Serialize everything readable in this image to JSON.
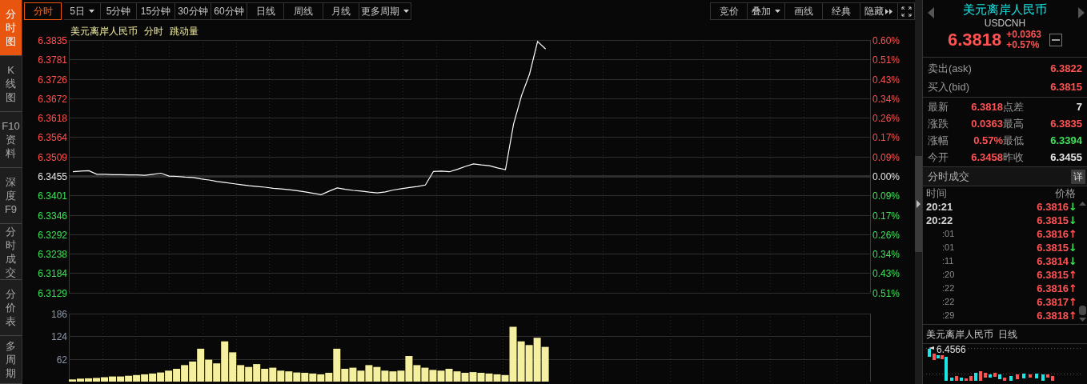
{
  "side_tabs": [
    {
      "label": "分时图",
      "selected": true
    },
    {
      "label": "K线图",
      "selected": false
    },
    {
      "label": "F10资料",
      "selected": false
    },
    {
      "label": "深度F9",
      "selected": false
    },
    {
      "label": "分时成交",
      "selected": false
    },
    {
      "label": "分价表",
      "selected": false
    },
    {
      "label": "多周期",
      "selected": false
    }
  ],
  "period_tabs": [
    {
      "label": "分时",
      "selected": true,
      "dropdown": false
    },
    {
      "label": "5日",
      "selected": false,
      "dropdown": true
    },
    {
      "label": "5分钟",
      "selected": false,
      "dropdown": false
    },
    {
      "label": "15分钟",
      "selected": false,
      "dropdown": false
    },
    {
      "label": "30分钟",
      "selected": false,
      "dropdown": false
    },
    {
      "label": "60分钟",
      "selected": false,
      "dropdown": false
    },
    {
      "label": "日线",
      "selected": false,
      "dropdown": false
    },
    {
      "label": "周线",
      "selected": false,
      "dropdown": false
    },
    {
      "label": "月线",
      "selected": false,
      "dropdown": false
    },
    {
      "label": "更多周期",
      "selected": false,
      "dropdown": true
    }
  ],
  "tools": [
    {
      "label": "竞价",
      "kind": "plain"
    },
    {
      "label": "叠加",
      "kind": "dropdown"
    },
    {
      "label": "画线",
      "kind": "plain"
    },
    {
      "label": "经典",
      "kind": "plain"
    },
    {
      "label": "隐藏",
      "kind": "expand"
    },
    {
      "kind": "fullscreen"
    }
  ],
  "chart_title": [
    "美元离岸人民币",
    "分时",
    "跳动量"
  ],
  "percent_axis": [
    {
      "label": "0.60%",
      "color": "#ff5252"
    },
    {
      "label": "0.51%",
      "color": "#ff5252"
    },
    {
      "label": "0.43%",
      "color": "#ff5252"
    },
    {
      "label": "0.34%",
      "color": "#ff5252"
    },
    {
      "label": "0.26%",
      "color": "#ff5252"
    },
    {
      "label": "0.17%",
      "color": "#ff5252"
    },
    {
      "label": "0.09%",
      "color": "#ff5252"
    },
    {
      "label": "0.00%",
      "color": "#e6e6e6"
    },
    {
      "label": "0.09%",
      "color": "#3ee05a"
    },
    {
      "label": "0.17%",
      "color": "#3ee05a"
    },
    {
      "label": "0.26%",
      "color": "#3ee05a"
    },
    {
      "label": "0.34%",
      "color": "#3ee05a"
    },
    {
      "label": "0.43%",
      "color": "#3ee05a"
    },
    {
      "label": "0.51%",
      "color": "#3ee05a"
    }
  ],
  "price_chart": {
    "chart_data": {
      "type": "line",
      "categories": [
        null,
        null,
        null,
        null,
        null,
        null,
        null,
        null,
        null,
        null,
        null,
        null,
        null,
        null,
        null,
        null,
        null,
        null,
        null,
        null,
        null,
        null,
        null,
        null,
        null,
        null,
        null,
        null,
        null,
        null,
        null,
        null,
        null,
        null,
        null,
        null,
        null,
        null,
        null,
        null,
        null,
        null,
        null,
        null,
        null,
        null,
        null,
        null,
        null,
        null,
        null,
        null,
        null,
        null,
        null,
        null,
        null,
        null,
        null,
        null
      ],
      "series": [
        {
          "color": "#ffffff",
          "values": [
            6.3467,
            6.3469,
            6.347,
            6.346,
            6.346,
            6.3459,
            6.3459,
            6.3458,
            6.3458,
            6.3457,
            6.346,
            6.3463,
            6.3455,
            6.3454,
            6.3452,
            6.3451,
            6.3447,
            6.3444,
            6.344,
            6.3437,
            6.3434,
            6.3431,
            6.3428,
            6.3426,
            6.3424,
            6.3421,
            6.3419,
            6.3417,
            6.3414,
            6.3411,
            6.3407,
            6.3403,
            6.3413,
            6.3422,
            6.3418,
            6.3415,
            6.3413,
            6.341,
            6.3408,
            6.3411,
            6.3416,
            6.342,
            6.3423,
            6.3426,
            6.343,
            6.3468,
            6.3469,
            6.3467,
            6.3474,
            6.3482,
            6.3489,
            6.3486,
            6.3484,
            6.3478,
            6.3473,
            6.36,
            6.368,
            6.374,
            6.3831,
            6.381
          ]
        }
      ],
      "grid": true,
      "ref_lines": [
        {
          "axis": "y",
          "value": 6.3455
        }
      ],
      "ylim": [
        6.3129,
        6.3835
      ],
      "yticks": [
        {
          "value": 6.3835,
          "label": "6.3835"
        },
        {
          "value": 6.3781,
          "label": "6.3781"
        },
        {
          "value": 6.3726,
          "label": "6.3726"
        },
        {
          "value": 6.3672,
          "label": "6.3672"
        },
        {
          "value": 6.3618,
          "label": "6.3618"
        },
        {
          "value": 6.3564,
          "label": "6.3564"
        },
        {
          "value": 6.3509,
          "label": "6.3509"
        },
        {
          "value": 6.3455,
          "label": "6.3455"
        },
        {
          "value": 6.3401,
          "label": "6.3401"
        },
        {
          "value": 6.3346,
          "label": "6.3346"
        },
        {
          "value": 6.3292,
          "label": "6.3292"
        },
        {
          "value": 6.3238,
          "label": "6.3238"
        },
        {
          "value": 6.3184,
          "label": "6.3184"
        },
        {
          "value": 6.3129,
          "label": "6.3129"
        }
      ]
    }
  },
  "volume_chart": {
    "chart_data": {
      "type": "bar",
      "categories": [
        null,
        null,
        null,
        null,
        null,
        null,
        null,
        null,
        null,
        null,
        null,
        null,
        null,
        null,
        null,
        null,
        null,
        null,
        null,
        null,
        null,
        null,
        null,
        null,
        null,
        null,
        null,
        null,
        null,
        null,
        null,
        null,
        null,
        null,
        null,
        null,
        null,
        null,
        null,
        null,
        null,
        null,
        null,
        null,
        null,
        null,
        null,
        null,
        null,
        null,
        null,
        null,
        null,
        null,
        null,
        null,
        null,
        null,
        null,
        null
      ],
      "series": [
        {
          "color": "#f5f0a0",
          "values": [
            6,
            8,
            9,
            10,
            12,
            14,
            14,
            16,
            18,
            20,
            22,
            25,
            30,
            35,
            45,
            55,
            90,
            60,
            50,
            110,
            80,
            45,
            40,
            48,
            35,
            38,
            30,
            28,
            25,
            24,
            22,
            20,
            24,
            90,
            35,
            38,
            30,
            45,
            40,
            30,
            28,
            30,
            70,
            45,
            38,
            32,
            30,
            35,
            28,
            24,
            26,
            24,
            22,
            20,
            18,
            150,
            110,
            100,
            120,
            95
          ]
        }
      ],
      "grid": true,
      "ylim": [
        0,
        186
      ],
      "yticks": [
        62,
        124,
        186
      ]
    }
  },
  "quote": {
    "name": "美元离岸人民币",
    "code": "USDCNH",
    "price": "6.3818",
    "change": "+0.0363",
    "change_pct": "+0.57%"
  },
  "order_book": [
    {
      "label": "卖出(ask)",
      "value": "6.3822"
    },
    {
      "label": "买入(bid)",
      "value": "6.3815"
    }
  ],
  "stats": [
    {
      "label": "最新",
      "value": "6.3818",
      "color": "#ff5252"
    },
    {
      "label": "点差",
      "value": "7",
      "color": "#e6e6e6"
    },
    {
      "label": "涨跌",
      "value": "0.0363",
      "color": "#ff5252"
    },
    {
      "label": "最高",
      "value": "6.3835",
      "color": "#ff5252"
    },
    {
      "label": "涨幅",
      "value": "0.57%",
      "color": "#ff5252"
    },
    {
      "label": "最低",
      "value": "6.3394",
      "color": "#3ee05a"
    },
    {
      "label": "今开",
      "value": "6.3458",
      "color": "#ff5252"
    },
    {
      "label": "昨收",
      "value": "6.3455",
      "color": "#e6e6e6"
    }
  ],
  "trades": {
    "title": "分时成交",
    "detail_button": "详",
    "columns": [
      "时间",
      "价格"
    ],
    "rows": [
      {
        "time": "20:21",
        "kind": "minute",
        "price": "6.3816",
        "arrow": "↓",
        "color": "#3ee05a"
      },
      {
        "time": "20:22",
        "kind": "minute",
        "price": "6.3815",
        "arrow": "↓",
        "color": "#3ee05a"
      },
      {
        "time": ":01",
        "kind": "second",
        "price": "6.3816",
        "arrow": "↑",
        "color": "#ff5252"
      },
      {
        "time": ":01",
        "kind": "second",
        "price": "6.3815",
        "arrow": "↓",
        "color": "#3ee05a"
      },
      {
        "time": ":11",
        "kind": "second",
        "price": "6.3814",
        "arrow": "↓",
        "color": "#3ee05a"
      },
      {
        "time": ":20",
        "kind": "second",
        "price": "6.3815",
        "arrow": "↑",
        "color": "#ff5252"
      },
      {
        "time": ":22",
        "kind": "second",
        "price": "6.3816",
        "arrow": "↑",
        "color": "#ff5252"
      },
      {
        "time": ":22",
        "kind": "second",
        "price": "6.3817",
        "arrow": "↑",
        "color": "#ff5252"
      },
      {
        "time": ":29",
        "kind": "second",
        "price": "6.3818",
        "arrow": "↑",
        "color": "#ff5252"
      }
    ]
  },
  "daily_panel": {
    "title": [
      "美元离岸人民币",
      "日线"
    ],
    "high_label": "6.4566"
  }
}
